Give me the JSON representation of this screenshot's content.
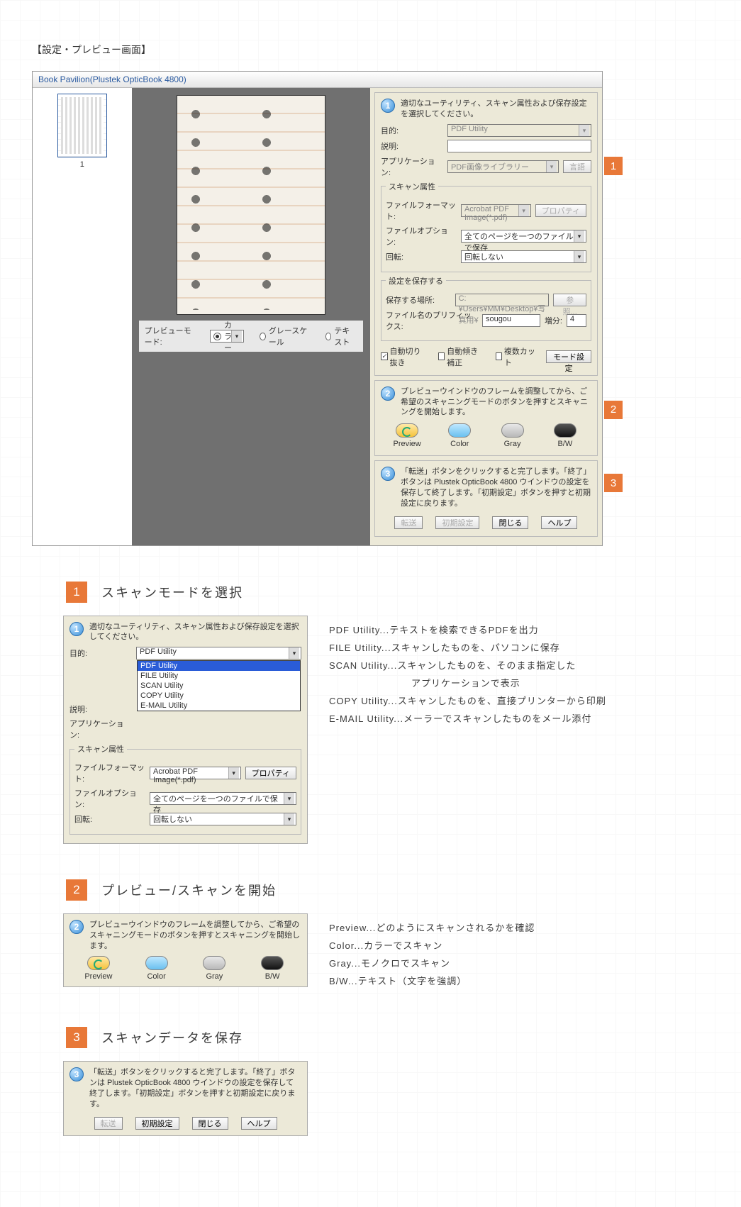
{
  "page_heading": "【設定・プレビュー画面】",
  "window": {
    "title": "Book Pavilion(Plustek OpticBook 4800)",
    "thumb_number": "1",
    "preview_mode_label": "プレビューモード:",
    "radio_color": "カラー",
    "radio_gray": "グレースケール",
    "radio_text": "テキスト"
  },
  "step1": {
    "text": "適切なユーティリティ、スキャン属性および保存設定を選択してください。",
    "purpose_label": "目的:",
    "purpose_value": "PDF Utility",
    "desc_label": "説明:",
    "desc_value": "",
    "app_label": "アプリケーション:",
    "app_value": "PDF画像ライブラリー",
    "lang_btn": "言語",
    "scan_attr_legend": "スキャン属性",
    "format_label": "ファイルフォーマット:",
    "format_value": "Acrobat PDF Image(*.pdf)",
    "property_btn": "プロパティ",
    "option_label": "ファイルオプション:",
    "option_value": "全てのページを一つのファイルで保存",
    "rotate_label": "回転:",
    "rotate_value": "回転しない",
    "save_legend": "設定を保存する",
    "save_loc_label": "保存する場所:",
    "save_loc_value": "C:¥Users¥MM¥Desktop¥写真用¥",
    "browse_btn": "参照...",
    "prefix_label": "ファイル名のプリフィックス:",
    "prefix_value": "sougou",
    "incr_label": "増分:",
    "incr_value": "4",
    "chk_autocrop": "自動切り抜き",
    "chk_skew": "自動傾き補正",
    "chk_multi": "複数カット",
    "mode_btn": "モード設定"
  },
  "step2": {
    "text": "プレビューウインドウのフレームを調整してから、ご希望のスキャニングモードのボタンを押すとスキャニングを開始します。",
    "preview": "Preview",
    "color": "Color",
    "gray": "Gray",
    "bw": "B/W"
  },
  "step3": {
    "text": "「転送」ボタンをクリックすると完了します。「終了」ボタンは Plustek OpticBook 4800 ウインドウの設定を保存して終了します。「初期設定」ボタンを押すと初期設定に戻ります。",
    "transfer": "転送",
    "default": "初期設定",
    "close": "閉じる",
    "help": "ヘルプ"
  },
  "callouts": {
    "c1": "1",
    "c2": "2",
    "c3": "3"
  },
  "sec1": {
    "num": "1",
    "title": "スキャンモードを選択",
    "dd": {
      "pdf": "PDF Utility",
      "file": "FILE Utility",
      "scan": "SCAN Utility",
      "copy": "COPY Utility",
      "email": "E-MAIL Utility"
    },
    "desc": {
      "pdf": "PDF Utility...テキストを検索できるPDFを出力",
      "file": "FILE Utility...スキャンしたものを、パソコンに保存",
      "scan": "SCAN Utility...スキャンしたものを、そのまま指定した",
      "scan2": "アプリケーションで表示",
      "copy": "COPY Utility...スキャンしたものを、直接プリンターから印刷",
      "email": "E-MAIL Utility...メーラーでスキャンしたものをメール添付"
    }
  },
  "sec2": {
    "num": "2",
    "title": "プレビュー/スキャンを開始",
    "desc": {
      "preview": "Preview...どのようにスキャンされるかを確認",
      "color": "Color...カラーでスキャン",
      "gray": "Gray...モノクロでスキャン",
      "bw": "B/W...テキスト（文字を強調）"
    }
  },
  "sec3": {
    "num": "3",
    "title": "スキャンデータを保存",
    "panel_text": "「転送」ボタンをクリックすると完了します。「終了」ボタンは Plustek OpticBook 4800 ウインドウの設定を保存して終了します。「初期設定」ボタンを押すと初期設定に戻ります。"
  }
}
